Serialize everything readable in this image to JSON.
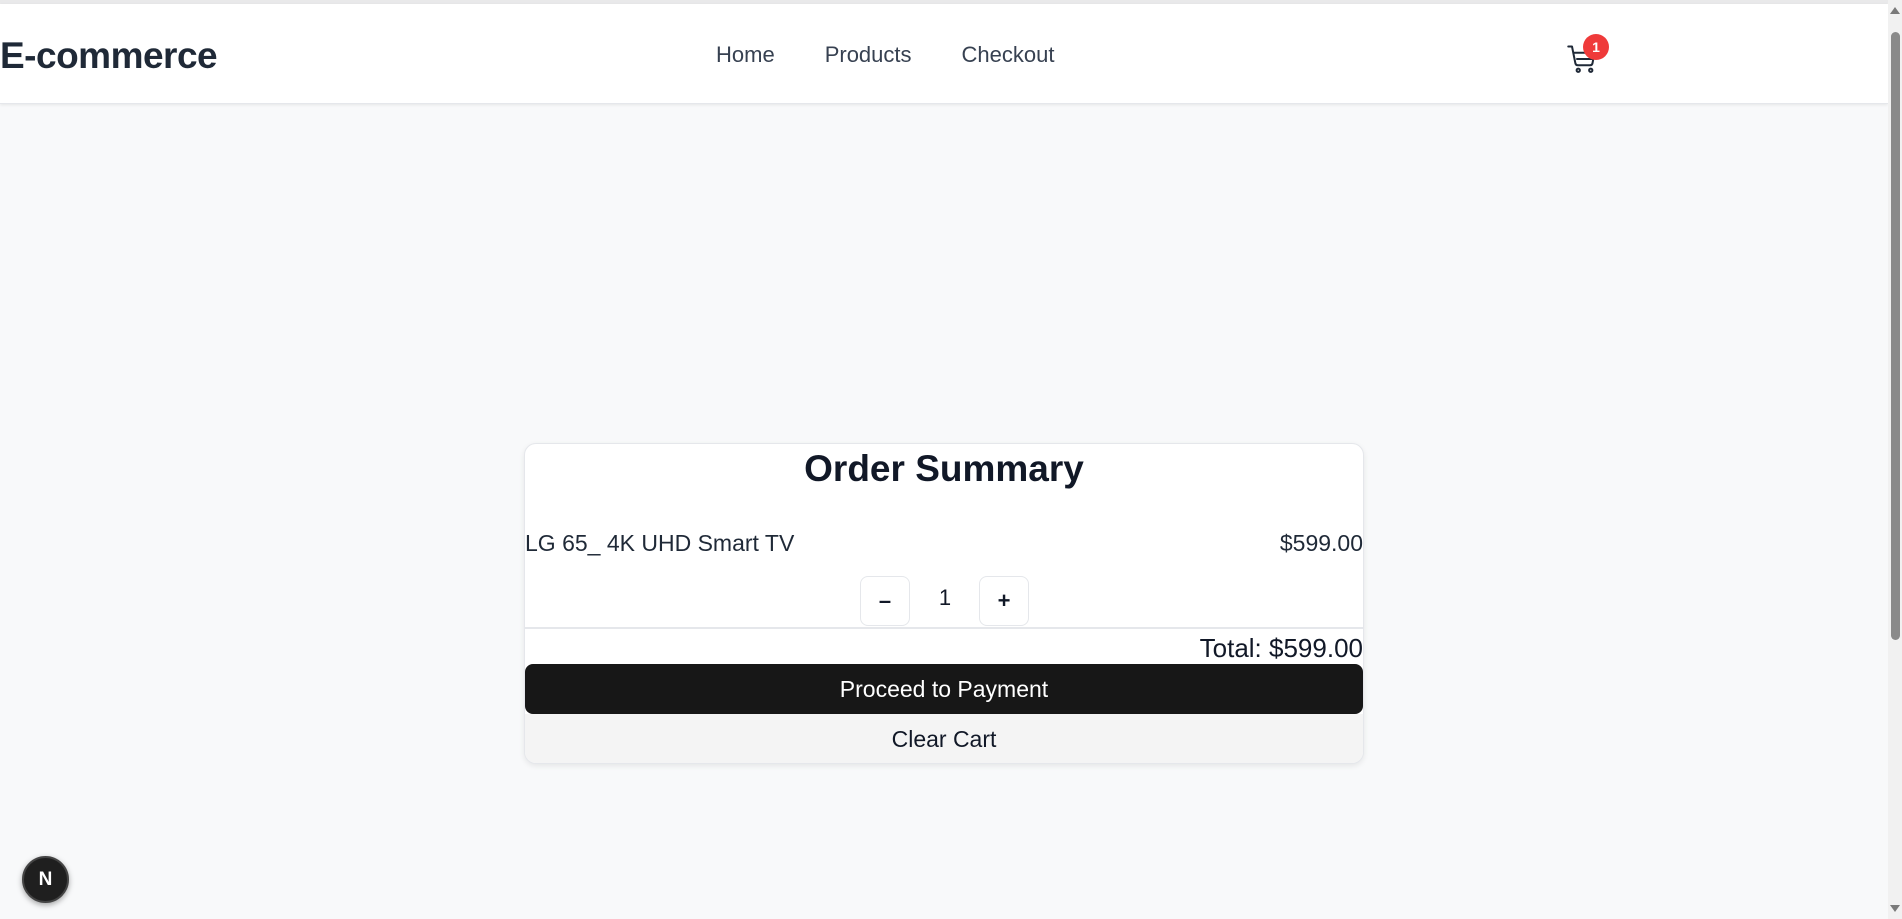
{
  "header": {
    "brand": "E-commerce",
    "nav": [
      "Home",
      "Products",
      "Checkout"
    ],
    "cart": {
      "icon": "shopping-cart-icon",
      "count": "1"
    }
  },
  "order": {
    "title": "Order Summary",
    "item": {
      "name": "LG 65_ 4K UHD Smart TV",
      "price": "$599.00",
      "quantity": "1"
    },
    "decrement_label": "–",
    "increment_label": "+",
    "total": "Total: $599.00",
    "pay_label": "Proceed to Payment",
    "clear_label": "Clear Cart"
  },
  "dev_badge": {
    "label": "N",
    "icon": "nextjs-icon"
  },
  "colors": {
    "badge": "#ef3a3a",
    "primary_button": "#171717",
    "text": "#111827",
    "background": "#f8f9fa"
  }
}
